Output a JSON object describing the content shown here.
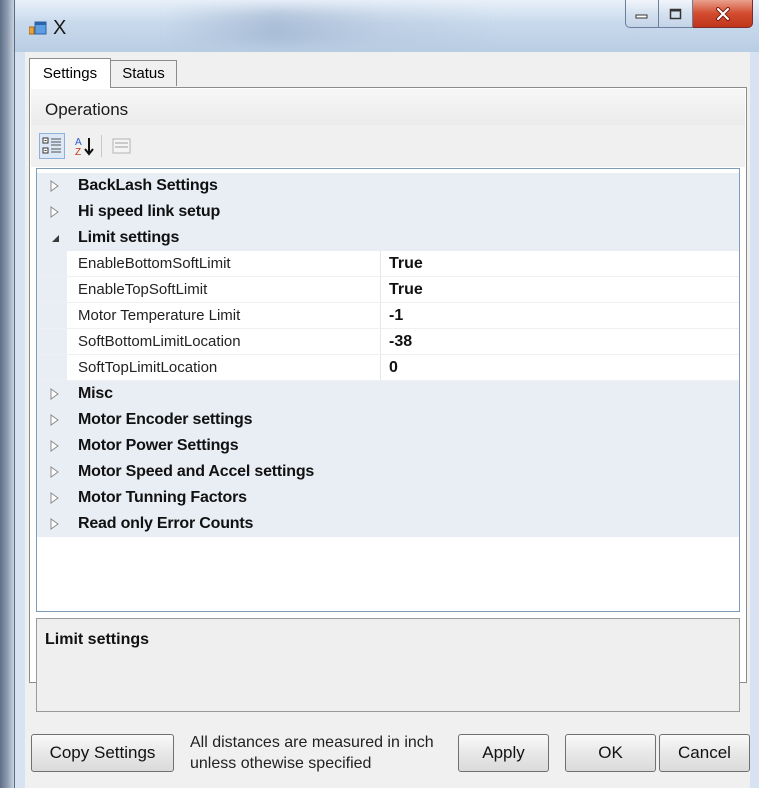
{
  "window": {
    "title": "X"
  },
  "tabs": [
    {
      "label": "Settings",
      "active": true
    },
    {
      "label": "Status",
      "active": false
    }
  ],
  "section_header": "Operations",
  "toolbar": {
    "icons": [
      "categorized-icon",
      "alphabetical-sort-icon",
      "property-pages-icon"
    ]
  },
  "grid": {
    "rows": [
      {
        "type": "category",
        "label": "BackLash Settings",
        "expanded": false
      },
      {
        "type": "category",
        "label": "Hi speed link setup",
        "expanded": false
      },
      {
        "type": "category",
        "label": "Limit settings",
        "expanded": true
      },
      {
        "type": "property",
        "name": "EnableBottomSoftLimit",
        "value": "True"
      },
      {
        "type": "property",
        "name": "EnableTopSoftLimit",
        "value": "True"
      },
      {
        "type": "property",
        "name": "Motor Temperature Limit",
        "value": "-1"
      },
      {
        "type": "property",
        "name": "SoftBottomLimitLocation",
        "value": "-38"
      },
      {
        "type": "property",
        "name": "SoftTopLimitLocation",
        "value": "0"
      },
      {
        "type": "category",
        "label": "Misc",
        "expanded": false
      },
      {
        "type": "category",
        "label": "Motor Encoder settings",
        "expanded": false
      },
      {
        "type": "category",
        "label": "Motor Power Settings",
        "expanded": false
      },
      {
        "type": "category",
        "label": "Motor Speed and Accel settings",
        "expanded": false
      },
      {
        "type": "category",
        "label": "Motor Tunning Factors",
        "expanded": false
      },
      {
        "type": "category",
        "label": "Read only Error Counts",
        "expanded": false
      }
    ]
  },
  "description": {
    "title": "Limit settings"
  },
  "footer": {
    "copy_label": "Copy Settings",
    "note": "All distances are measured in inch unless othewise specified",
    "apply_label": "Apply",
    "ok_label": "OK",
    "cancel_label": "Cancel"
  },
  "colors": {
    "category_background": "#e9eef5",
    "grid_border": "#7f9db9",
    "close_button": "#c0361c"
  }
}
